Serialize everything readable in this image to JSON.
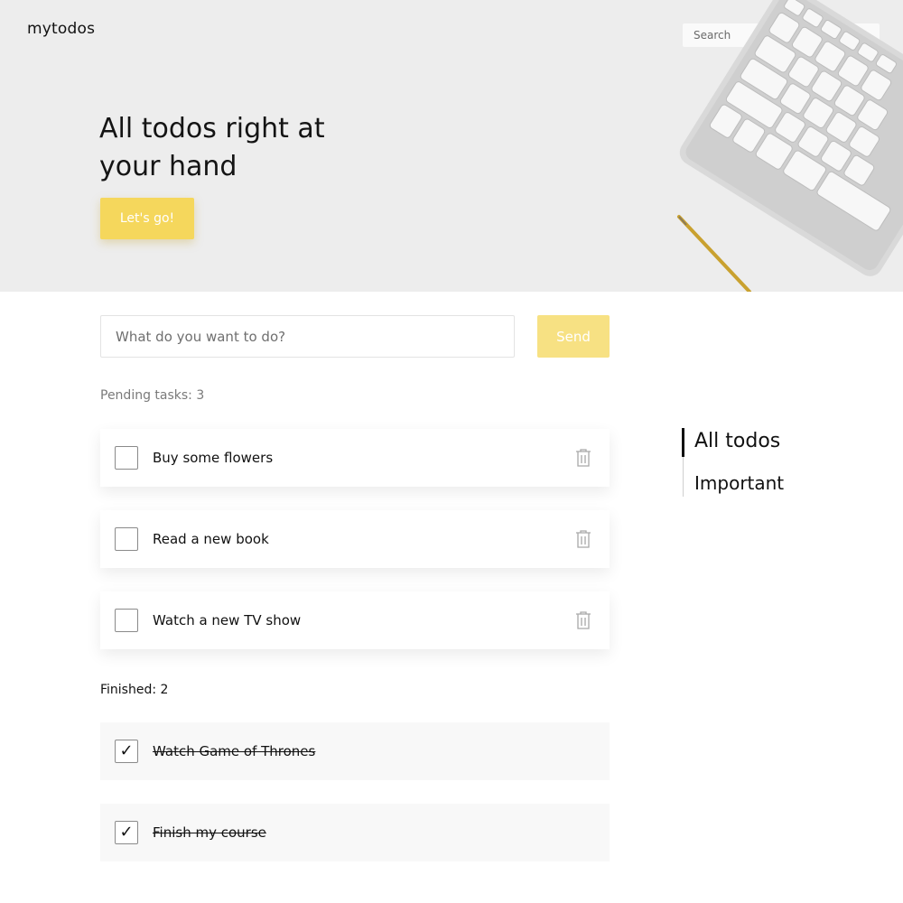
{
  "header": {
    "brand": "mytodos",
    "search_placeholder": "Search"
  },
  "hero": {
    "headline": "All todos right at your hand",
    "cta_label": "Let's go!"
  },
  "composer": {
    "placeholder": "What do you want to do?",
    "send_label": "Send"
  },
  "pending": {
    "label": "Pending tasks: 3",
    "items": [
      {
        "text": "Buy some flowers",
        "checked": false
      },
      {
        "text": "Read a new book",
        "checked": false
      },
      {
        "text": "Watch a new TV show",
        "checked": false
      }
    ]
  },
  "finished": {
    "label": "Finished: 2",
    "items": [
      {
        "text": "Watch Game of Thrones",
        "checked": true
      },
      {
        "text": "Finish my course",
        "checked": true
      }
    ]
  },
  "sidebar": {
    "items": [
      {
        "label": "All todos",
        "active": true
      },
      {
        "label": "Important",
        "active": false
      }
    ]
  },
  "icons": {
    "checkmark": "✓",
    "trash": "trash-icon"
  },
  "colors": {
    "accent": "#f5d75c",
    "accent_light": "#f7e183",
    "hero_bg": "#ededed"
  }
}
